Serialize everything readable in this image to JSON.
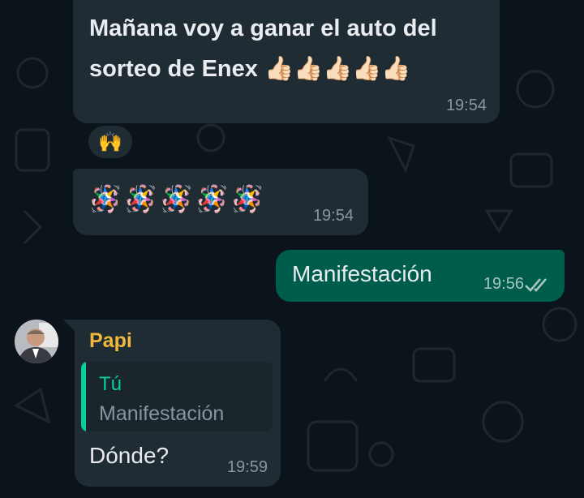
{
  "messages": [
    {
      "text": "Mañana voy a ganar el auto del sorteo de Enex 👍🏻👍🏻👍🏻👍🏻👍🏻",
      "time": "19:54",
      "reaction": "🙌"
    },
    {
      "text": "🪅🪅🪅🪅🪅",
      "time": "19:54"
    },
    {
      "text": "Manifestación",
      "time": "19:56"
    },
    {
      "sender": "Papi",
      "quote": {
        "name": "Tú",
        "text": "Manifestación"
      },
      "text": "Dónde?",
      "time": "19:59"
    }
  ],
  "colors": {
    "background": "#0b141a",
    "incoming_bubble": "#1f2c34",
    "outgoing_bubble": "#005c4b",
    "sender_name": "#f2b83a",
    "quote_accent": "#06cf9c",
    "read_ticks": "#a7c7bf"
  },
  "icons": [
    "double-check-icon",
    "avatar-photo"
  ]
}
